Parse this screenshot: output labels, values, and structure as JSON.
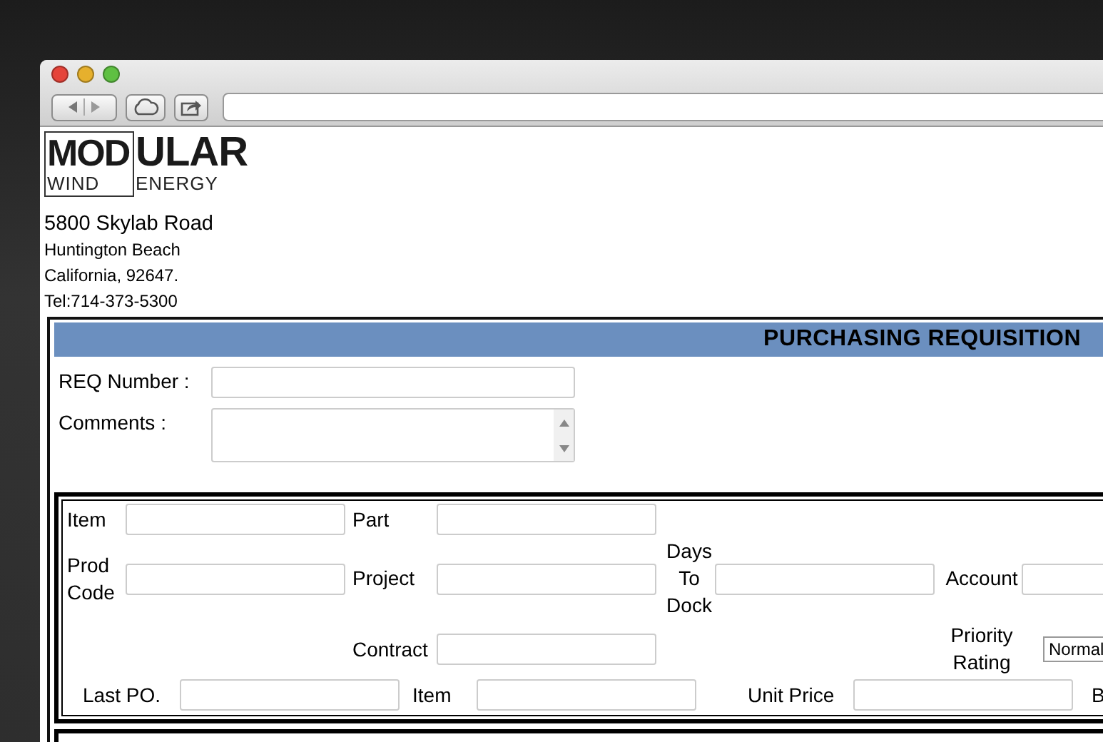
{
  "company": {
    "logo": {
      "framed_top": "MOD",
      "framed_bottom": "WIND",
      "top": "ULAR",
      "bottom": "ENERGY"
    },
    "address_lines": [
      {
        "text": "5800 Skylab Road",
        "kind": "street"
      },
      {
        "text": "Huntington Beach",
        "kind": "line"
      },
      {
        "text": "California, 92647.",
        "kind": "line"
      },
      {
        "text": "Tel:714-373-5300",
        "kind": "line"
      }
    ]
  },
  "form": {
    "title": "PURCHASING REQUISITION",
    "fields": [
      {
        "label": "REQ Number :",
        "kind": "input"
      },
      {
        "label": "Comments :",
        "kind": "textarea"
      }
    ],
    "item_section": {
      "rows": [
        [
          {
            "label": "Item",
            "kind": "input"
          },
          {
            "label": "Part",
            "kind": "input"
          }
        ],
        [
          {
            "label": "Prod Code",
            "kind": "input"
          },
          {
            "label": "Project",
            "kind": "input"
          },
          {
            "label": "Days To Dock",
            "kind": "input"
          },
          {
            "label": "Account",
            "kind": "input"
          }
        ],
        [
          {
            "kind": "blank"
          },
          {
            "label": "Contract",
            "kind": "input"
          },
          {
            "kind": "blank"
          },
          {
            "label": "Priority Rating",
            "kind": "select",
            "value": "Normal"
          }
        ]
      ],
      "last_row": [
        {
          "label": "Last PO.",
          "kind": "input"
        },
        {
          "label": "Item",
          "kind": "input"
        },
        {
          "label": "Unit Price",
          "kind": "input"
        },
        {
          "label": "B",
          "kind": "none"
        }
      ]
    }
  }
}
